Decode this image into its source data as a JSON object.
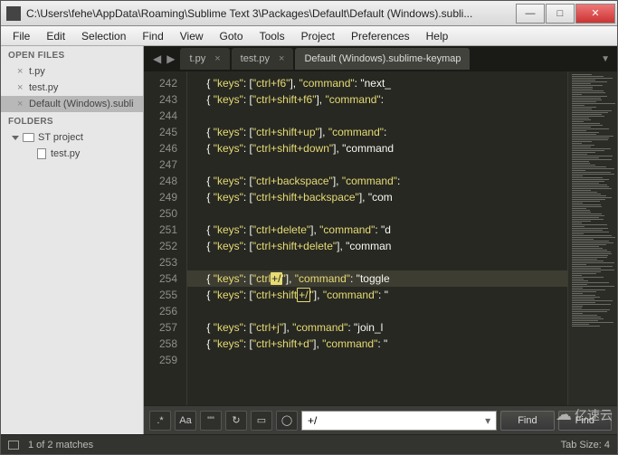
{
  "titlebar": {
    "title": "C:\\Users\\fehe\\AppData\\Roaming\\Sublime Text 3\\Packages\\Default\\Default (Windows).subli..."
  },
  "menu": {
    "items": [
      "File",
      "Edit",
      "Selection",
      "Find",
      "View",
      "Goto",
      "Tools",
      "Project",
      "Preferences",
      "Help"
    ]
  },
  "sidebar": {
    "open_files_label": "OPEN FILES",
    "open_files": [
      {
        "name": "t.py",
        "active": false
      },
      {
        "name": "test.py",
        "active": false
      },
      {
        "name": "Default (Windows).subli",
        "active": true
      }
    ],
    "folders_label": "FOLDERS",
    "folder_name": "ST project",
    "folder_files": [
      "test.py"
    ]
  },
  "tabs": {
    "items": [
      {
        "label": "t.py",
        "active": false
      },
      {
        "label": "test.py",
        "active": false
      },
      {
        "label": "Default (Windows).sublime-keymap",
        "active": true
      }
    ]
  },
  "editor": {
    "first_line": 242,
    "highlighted_line": 254,
    "lines": [
      "    { \"keys\": [\"ctrl+f6\"], \"command\": \"next_",
      "    { \"keys\": [\"ctrl+shift+f6\"], \"command\":",
      "",
      "    { \"keys\": [\"ctrl+shift+up\"], \"command\":",
      "    { \"keys\": [\"ctrl+shift+down\"], \"command",
      "",
      "    { \"keys\": [\"ctrl+backspace\"], \"command\":",
      "    { \"keys\": [\"ctrl+shift+backspace\"], \"com",
      "",
      "    { \"keys\": [\"ctrl+delete\"], \"command\": \"d",
      "    { \"keys\": [\"ctrl+shift+delete\"], \"comman",
      "",
      "    { \"keys\": [\"ctrl+/\"], \"command\": \"toggle",
      "    { \"keys\": [\"ctrl+shift+/\"], \"command\": \"",
      "",
      "    { \"keys\": [\"ctrl+j\"], \"command\": \"join_l",
      "    { \"keys\": [\"ctrl+shift+d\"], \"command\": \"",
      ""
    ]
  },
  "find": {
    "regex_btn": ".*",
    "case_btn": "Aa",
    "word_btn": "\"\"",
    "wrap_btn": "↻",
    "sel_btn": "▭",
    "hl_btn": "◯",
    "input_value": "+/",
    "find_label": "Find",
    "findall_label": "Find"
  },
  "status": {
    "matches": "1 of 2 matches",
    "tabsize": "Tab Size: 4"
  },
  "watermark": "亿速云"
}
